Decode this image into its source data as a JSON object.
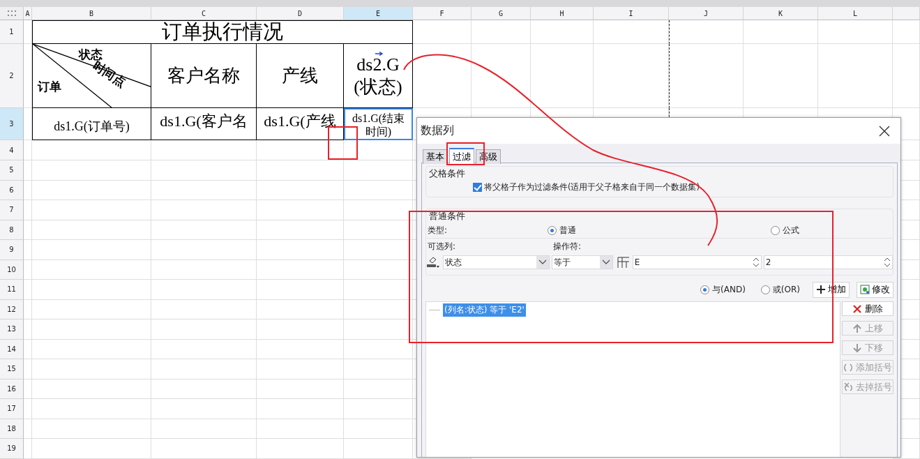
{
  "sheet": {
    "columns": [
      {
        "label": "A",
        "selected": false
      },
      {
        "label": "B",
        "selected": false
      },
      {
        "label": "C",
        "selected": false
      },
      {
        "label": "D",
        "selected": false
      },
      {
        "label": "E",
        "selected": true
      },
      {
        "label": "F",
        "selected": false
      },
      {
        "label": "G",
        "selected": false
      },
      {
        "label": "H",
        "selected": false
      },
      {
        "label": "I",
        "selected": false
      },
      {
        "label": "J",
        "selected": false
      },
      {
        "label": "K",
        "selected": false
      },
      {
        "label": "L",
        "selected": false
      }
    ],
    "rows": [
      {
        "label": "1",
        "selected": false
      },
      {
        "label": "2",
        "selected": false
      },
      {
        "label": "3",
        "selected": true
      },
      {
        "label": "4",
        "selected": false
      },
      {
        "label": "5",
        "selected": false
      },
      {
        "label": "6",
        "selected": false
      },
      {
        "label": "7",
        "selected": false
      },
      {
        "label": "8",
        "selected": false
      },
      {
        "label": "9",
        "selected": false
      },
      {
        "label": "10",
        "selected": false
      },
      {
        "label": "11",
        "selected": false
      },
      {
        "label": "12",
        "selected": false
      },
      {
        "label": "13",
        "selected": false
      },
      {
        "label": "14",
        "selected": false
      },
      {
        "label": "15",
        "selected": false
      },
      {
        "label": "16",
        "selected": false
      },
      {
        "label": "17",
        "selected": false
      },
      {
        "label": "18",
        "selected": false
      },
      {
        "label": "19",
        "selected": false
      }
    ],
    "title": "订单执行情况",
    "diagonal_header": {
      "top": "状态",
      "middle": "时间点",
      "bottom": "订单"
    },
    "header_cells": [
      "客户名称",
      "产线",
      "ds2.G(状态)"
    ],
    "data_cells": [
      {
        "text": "ds1.G(订单号)",
        "selected": false
      },
      {
        "text": "ds1.G(客户名",
        "selected": false
      },
      {
        "text": "ds1.G(产线",
        "selected": false
      },
      {
        "text": "ds1.G(结束时间)",
        "selected": true
      }
    ]
  },
  "dialog": {
    "title": "数据列",
    "tabs": [
      {
        "label": "基本",
        "selected": false
      },
      {
        "label": "过滤",
        "selected": true
      },
      {
        "label": "高级",
        "selected": false
      }
    ],
    "parent_group": {
      "title": "父格条件",
      "checkbox": {
        "label": "将父格子作为过滤条件(适用于父子格来自于同一个数据集)",
        "checked": true
      }
    },
    "normal_group": {
      "title": "普通条件",
      "type_label": "类型:",
      "type_options": [
        {
          "label": "普通",
          "selected": true
        },
        {
          "label": "公式",
          "selected": false
        }
      ],
      "column_label": "可选列:",
      "operator_label": "操作符:",
      "column_value": "状态",
      "operator_value": "等于",
      "value_1": "E",
      "value_2": "2"
    },
    "logic_options": [
      {
        "label": "与(AND)",
        "selected": true
      },
      {
        "label": "或(OR)",
        "selected": false
      }
    ],
    "buttons": [
      {
        "label": "增加",
        "kind": "add"
      },
      {
        "label": "修改",
        "kind": "edit"
      }
    ],
    "conditions": [
      {
        "text": "(列名:状态) 等于 'E2'",
        "selected": true
      }
    ],
    "side_buttons": [
      {
        "label": "删除",
        "kind": "delete",
        "disabled": false
      },
      {
        "label": "上移",
        "kind": "up",
        "disabled": true
      },
      {
        "label": "下移",
        "kind": "down",
        "disabled": true
      },
      {
        "label": "添加括号",
        "kind": "add_brackets",
        "disabled": true
      },
      {
        "label": "去掉括号",
        "kind": "remove_brackets",
        "disabled": true
      }
    ]
  }
}
